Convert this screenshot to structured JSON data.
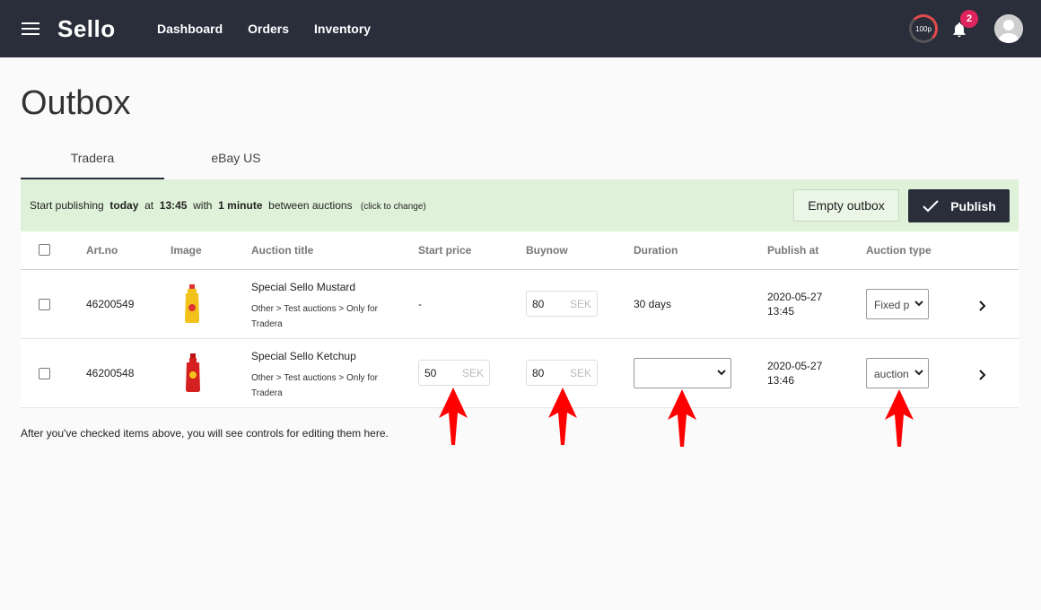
{
  "nav": {
    "brand": "Sello",
    "links": [
      "Dashboard",
      "Orders",
      "Inventory"
    ],
    "speed": "100p",
    "notifications": "2"
  },
  "page": {
    "title": "Outbox"
  },
  "tabs": [
    {
      "label": "Tradera",
      "active": true
    },
    {
      "label": "eBay US",
      "active": false
    }
  ],
  "publish_bar": {
    "prefix": "Start publishing",
    "day": "today",
    "at": "at",
    "time": "13:45",
    "with": "with",
    "interval": "1 minute",
    "suffix": "between auctions",
    "hint": "(click to change)",
    "empty_label": "Empty outbox",
    "publish_label": "Publish"
  },
  "table": {
    "headers": [
      "Art.no",
      "Image",
      "Auction title",
      "Start price",
      "Buynow",
      "Duration",
      "Publish at",
      "Auction type"
    ],
    "rows": [
      {
        "art_no": "46200549",
        "image": "mustard-bottle-icon",
        "title": "Special Sello Mustard",
        "category": "Other > Test auctions > Only for Tradera",
        "start_price": "-",
        "buynow": "80",
        "currency": "SEK",
        "duration": "30 days",
        "publish_date": "2020-05-27",
        "publish_time": "13:45",
        "auction_type": "Fixed p"
      },
      {
        "art_no": "46200548",
        "image": "ketchup-bottle-icon",
        "title": "Special Sello Ketchup",
        "category": "Other > Test auctions > Only for Tradera",
        "start_price": "50",
        "buynow": "80",
        "currency": "SEK",
        "duration": "",
        "publish_date": "2020-05-27",
        "publish_time": "13:46",
        "auction_type": "auction"
      }
    ]
  },
  "footer_note": "After you've checked items above, you will see controls for editing them here.",
  "colors": {
    "nav_bg": "#2a2e3b",
    "publish_bar_bg": "#dff2d9",
    "badge": "#e0245e",
    "arrow": "#ff0000"
  }
}
